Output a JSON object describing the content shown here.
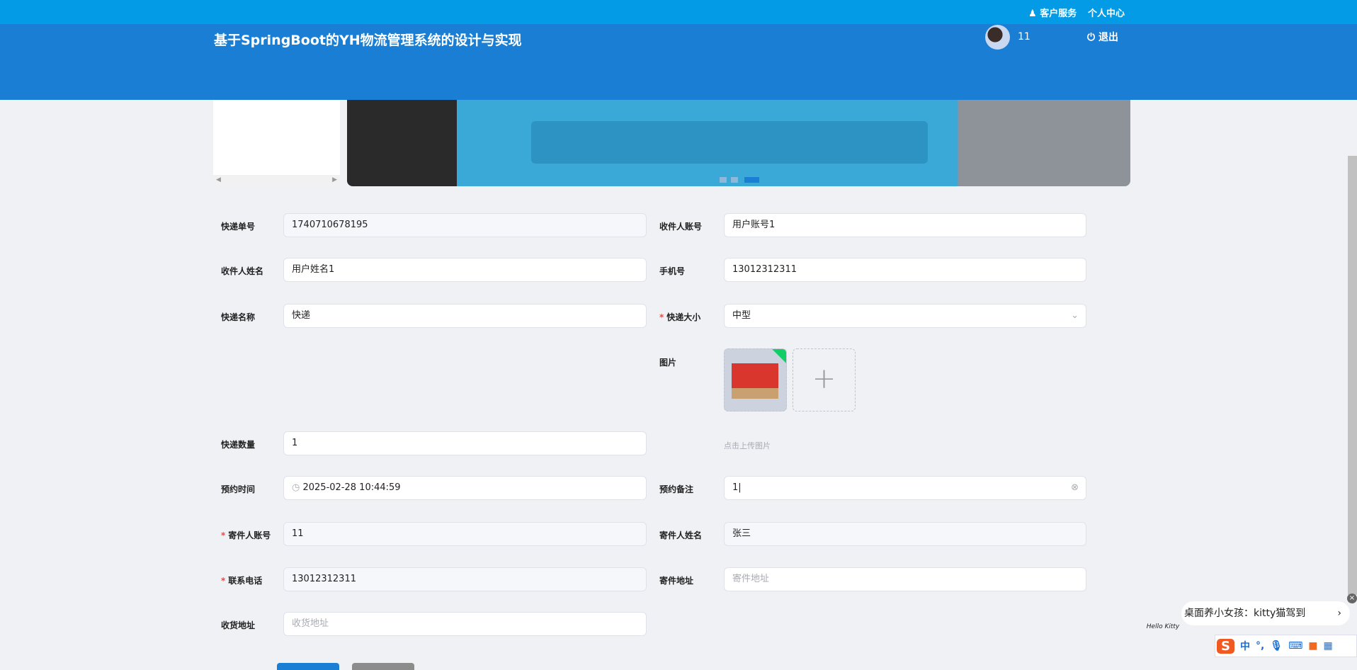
{
  "topbar": {
    "customer_service": "客户服务",
    "personal_center": "个人中心"
  },
  "header": {
    "title": "基于SpringBoot的YH物流管理系统的设计与实现",
    "username": "11",
    "logout": "退出"
  },
  "form": {
    "express_no": {
      "label": "快递单号",
      "value": "1740710678195"
    },
    "recipient_account": {
      "label": "收件人账号",
      "value": "用户账号1"
    },
    "recipient_name": {
      "label": "收件人姓名",
      "value": "用户姓名1"
    },
    "phone": {
      "label": "手机号",
      "value": "13012312311"
    },
    "express_name": {
      "label": "快递名称",
      "value": "快递"
    },
    "express_size": {
      "label": "快递大小",
      "value": "中型",
      "required": true
    },
    "picture": {
      "label": "图片",
      "hint": "点击上传图片"
    },
    "quantity": {
      "label": "快递数量",
      "value": "1"
    },
    "reserve_time": {
      "label": "预约时间",
      "value": "2025-02-28 10:44:59"
    },
    "reserve_note": {
      "label": "预约备注",
      "value": "1"
    },
    "sender_account": {
      "label": "寄件人账号",
      "value": "11",
      "required": true
    },
    "sender_name": {
      "label": "寄件人姓名",
      "value": "张三"
    },
    "contact_phone": {
      "label": "联系电话",
      "value": "13012312311",
      "required": true
    },
    "sender_address": {
      "label": "寄件地址",
      "placeholder": "寄件地址"
    },
    "receive_address": {
      "label": "收货地址",
      "placeholder": "收货地址"
    }
  },
  "widget": {
    "kitty_text": "桌面养小女孩：kitty猫驾到",
    "ime_mode": "中",
    "ime_punct": "°,"
  },
  "colors": {
    "topbar": "#039be5",
    "header": "#1a7fd4",
    "primary": "#1a7fd4"
  }
}
